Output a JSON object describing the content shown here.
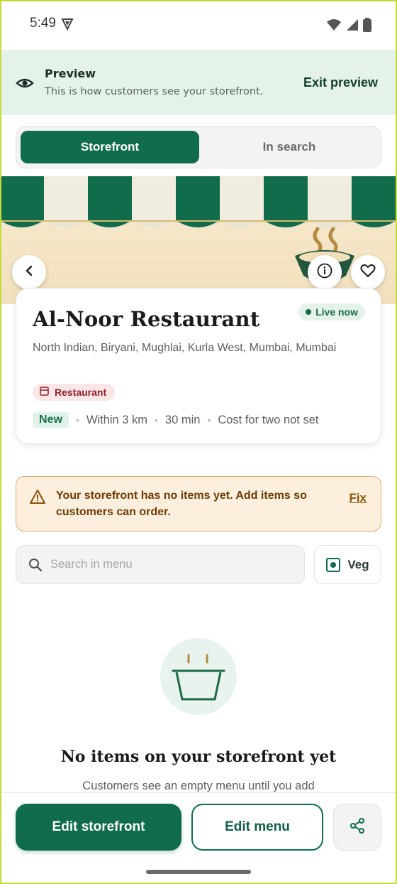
{
  "status_bar": {
    "time": "5:49"
  },
  "preview": {
    "title": "Preview",
    "subtitle": "This is how customers see your storefront.",
    "exit_label": "Exit preview"
  },
  "tabs": [
    {
      "label": "Storefront",
      "active": true
    },
    {
      "label": "In search",
      "active": false
    }
  ],
  "restaurant": {
    "name": "Al-Noor Restaurant",
    "status": "Live now",
    "cuisine": "North Indian, Biryani, Mughlai, Kurla West, Mumbai, Mumbai",
    "type_badge": "Restaurant",
    "new_badge": "New",
    "distance": "Within 3 km",
    "time": "30 min",
    "cost": "Cost for two not set"
  },
  "warning": {
    "text": "Your storefront has no items yet. Add items so customers can order.",
    "action": "Fix"
  },
  "search": {
    "placeholder": "Search in menu"
  },
  "veg_filter": {
    "label": "Veg"
  },
  "empty_state": {
    "title": "No items on your storefront yet",
    "subtitle": "Customers see an empty menu until you add"
  },
  "actions": {
    "edit_storefront": "Edit storefront",
    "edit_menu": "Edit menu"
  },
  "colors": {
    "brand_green": "#116c4c",
    "preview_bg": "#e4f2ea",
    "warning_bg": "#fcefdd",
    "warning_text": "#6e3b05",
    "badge_red": "#8e1f2e"
  }
}
